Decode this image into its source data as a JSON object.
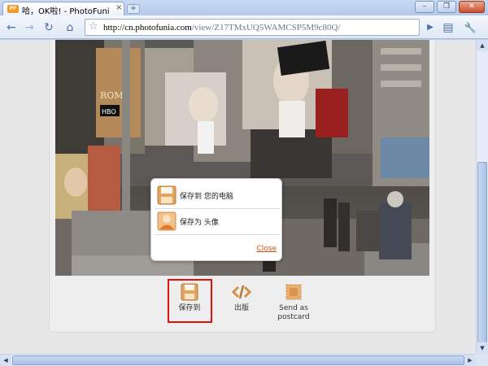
{
  "tab": {
    "title": "哈，OK啦! - PhotoFunia",
    "close": "×",
    "new_tab": "+"
  },
  "window": {
    "minimize": "–",
    "restore": "❐",
    "close": "✕"
  },
  "toolbar": {
    "back": "←",
    "forward": "→",
    "reload": "↻",
    "home": "⌂",
    "go": "▶",
    "page_menu": "▤",
    "tools_menu": "🔧"
  },
  "address": {
    "host": "http://cn.photofunia.com",
    "path": "/view/Z17TMxUQ5WAMCSP5M9c80Q/"
  },
  "popup": {
    "save_to_computer": "保存到 您的电脑",
    "save_as_avatar": "保存为 头像",
    "close": "Close"
  },
  "actions": {
    "save": "保存到",
    "publish": "出版",
    "postcard_line1": "Send as",
    "postcard_line2": "postcard"
  },
  "photo_signs": {
    "rome": "ROME",
    "hbo": "HBO"
  },
  "colors": {
    "accent_orange": "#d05010",
    "highlight_red": "#e01010",
    "chrome_blue": "#b9cdea"
  }
}
